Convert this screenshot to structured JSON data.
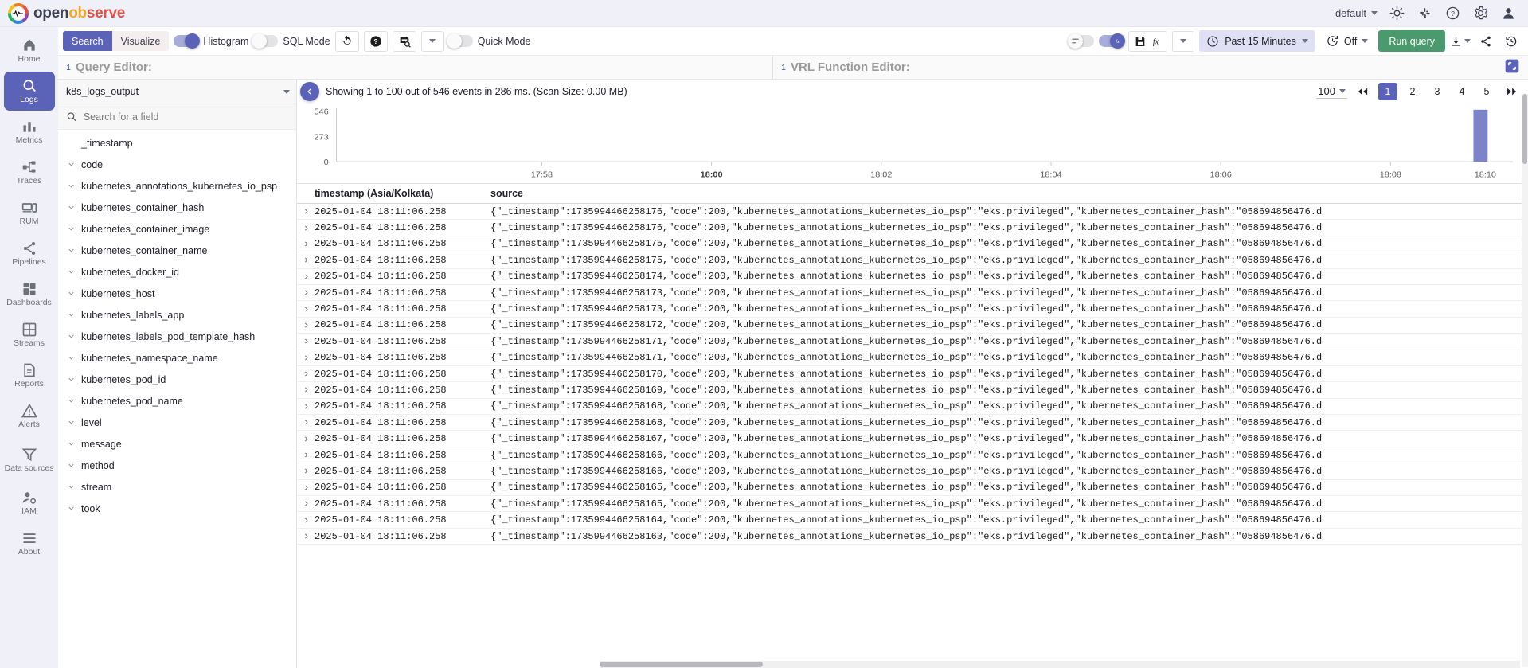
{
  "header": {
    "brand": {
      "open": "open",
      "obs": "ob",
      "serve": "serve"
    },
    "org": "default",
    "icons": {
      "light_mode": "sun-icon",
      "slack": "slack-icon",
      "help": "help-circle-icon",
      "settings": "gear-icon",
      "account": "user-avatar-icon"
    }
  },
  "sidebar": {
    "items": [
      {
        "label": "Home",
        "icon": "home-icon",
        "active": false
      },
      {
        "label": "Logs",
        "icon": "search-icon",
        "active": true
      },
      {
        "label": "Metrics",
        "icon": "bar-chart-icon",
        "active": false
      },
      {
        "label": "Traces",
        "icon": "traces-icon",
        "active": false
      },
      {
        "label": "RUM",
        "icon": "devices-icon",
        "active": false
      },
      {
        "label": "Pipelines",
        "icon": "share-nodes-icon",
        "active": false
      },
      {
        "label": "Dashboards",
        "icon": "grid-icon",
        "active": false
      },
      {
        "label": "Streams",
        "icon": "table-icon",
        "active": false
      },
      {
        "label": "Reports",
        "icon": "document-icon",
        "active": false
      },
      {
        "label": "Alerts",
        "icon": "warning-icon",
        "active": false
      },
      {
        "label": "Data sources",
        "icon": "funnel-icon",
        "active": false
      },
      {
        "label": "IAM",
        "icon": "user-gear-icon",
        "active": false
      },
      {
        "label": "About",
        "icon": "menu-icon",
        "active": false
      }
    ]
  },
  "toolbar": {
    "tab_search": "Search",
    "tab_visualize": "Visualize",
    "histogram_label": "Histogram",
    "histogram_on": true,
    "sql_mode_label": "SQL Mode",
    "sql_mode_on": false,
    "quick_mode_label": "Quick Mode",
    "quick_mode_on": false,
    "refresh_icon": "refresh-icon",
    "help_icon": "help-circle-icon",
    "saved_views_icon": "save-search-icon",
    "saved_views_caret": "chevron-down-icon",
    "wrap_toggle_on": false,
    "fn_toggle_on": true,
    "fn_toggle_label": "fx",
    "save_function_icon": "save-fx-icon",
    "save_function_caret": "chevron-down-icon",
    "time_range": "Past 15 Minutes",
    "time_icon": "clock-icon",
    "time_caret": "chevron-down-icon",
    "auto_refresh": "Off",
    "auto_refresh_icon": "clock-refresh-icon",
    "auto_refresh_caret": "chevron-down-icon",
    "run_query": "Run query",
    "download_icon": "download-icon",
    "download_caret": "chevron-down-icon",
    "share_icon": "share-icon",
    "history_icon": "history-icon"
  },
  "editors": {
    "query_line_no": "1",
    "query_placeholder": "Query Editor:",
    "vrl_line_no": "1",
    "vrl_placeholder": "VRL Function Editor:",
    "expand_icon": "expand-icon"
  },
  "fields_panel": {
    "stream": "k8s_logs_output",
    "stream_caret": "chevron-down-icon",
    "search_icon": "search-icon",
    "search_placeholder": "Search for a field",
    "search_value": "",
    "fields": [
      {
        "name": "_timestamp",
        "expandable": false
      },
      {
        "name": "code",
        "expandable": true
      },
      {
        "name": "kubernetes_annotations_kubernetes_io_psp",
        "expandable": true
      },
      {
        "name": "kubernetes_container_hash",
        "expandable": true
      },
      {
        "name": "kubernetes_container_image",
        "expandable": true
      },
      {
        "name": "kubernetes_container_name",
        "expandable": true
      },
      {
        "name": "kubernetes_docker_id",
        "expandable": true
      },
      {
        "name": "kubernetes_host",
        "expandable": true
      },
      {
        "name": "kubernetes_labels_app",
        "expandable": true
      },
      {
        "name": "kubernetes_labels_pod_template_hash",
        "expandable": true
      },
      {
        "name": "kubernetes_namespace_name",
        "expandable": true
      },
      {
        "name": "kubernetes_pod_id",
        "expandable": true
      },
      {
        "name": "kubernetes_pod_name",
        "expandable": true
      },
      {
        "name": "level",
        "expandable": true
      },
      {
        "name": "message",
        "expandable": true
      },
      {
        "name": "method",
        "expandable": true
      },
      {
        "name": "stream",
        "expandable": true
      },
      {
        "name": "took",
        "expandable": true
      }
    ]
  },
  "results": {
    "collapse_icon": "chevron-left-icon",
    "showing_text": "Showing 1 to 100 out of 546 events in 286 ms. (Scan Size: 0.00 MB)",
    "page_size": "100",
    "page_size_caret": "chevron-down-icon",
    "first_page_icon": "double-chevron-left-icon",
    "last_page_icon": "double-chevron-right-icon",
    "pages": [
      "1",
      "2",
      "3",
      "4",
      "5"
    ],
    "current_page": "1"
  },
  "chart_data": {
    "type": "bar",
    "title": "",
    "xlabel": "",
    "ylabel": "",
    "categories": [
      "17:58",
      "18:00",
      "18:02",
      "18:04",
      "18:06",
      "18:08",
      "18:10"
    ],
    "xtick_labels": [
      "17:58",
      "18:00",
      "18:02",
      "18:04",
      "18:06",
      "18:08",
      "18:10"
    ],
    "xtick_bold": [
      "18:00"
    ],
    "ytick_labels": [
      "546",
      "273",
      "0"
    ],
    "ylim": [
      0,
      546
    ],
    "grid": false,
    "legend": "none",
    "bar_color": "#7b83c9",
    "series": [
      {
        "name": "events",
        "values": [
          0,
          0,
          0,
          0,
          0,
          0,
          546
        ]
      }
    ],
    "bars": [
      {
        "x_fraction": 0.972,
        "value": 546
      }
    ]
  },
  "log_table": {
    "columns": [
      "timestamp (Asia/Kolkata)",
      "source"
    ],
    "expand_icon": "chevron-right-icon",
    "rows": [
      {
        "timestamp": "2025-01-04 18:11:06.258",
        "source": "{\"_timestamp\":1735994466258176,\"code\":200,\"kubernetes_annotations_kubernetes_io_psp\":\"eks.privileged\",\"kubernetes_container_hash\":\"058694856476.d"
      },
      {
        "timestamp": "2025-01-04 18:11:06.258",
        "source": "{\"_timestamp\":1735994466258176,\"code\":200,\"kubernetes_annotations_kubernetes_io_psp\":\"eks.privileged\",\"kubernetes_container_hash\":\"058694856476.d"
      },
      {
        "timestamp": "2025-01-04 18:11:06.258",
        "source": "{\"_timestamp\":1735994466258175,\"code\":200,\"kubernetes_annotations_kubernetes_io_psp\":\"eks.privileged\",\"kubernetes_container_hash\":\"058694856476.d"
      },
      {
        "timestamp": "2025-01-04 18:11:06.258",
        "source": "{\"_timestamp\":1735994466258175,\"code\":200,\"kubernetes_annotations_kubernetes_io_psp\":\"eks.privileged\",\"kubernetes_container_hash\":\"058694856476.d"
      },
      {
        "timestamp": "2025-01-04 18:11:06.258",
        "source": "{\"_timestamp\":1735994466258174,\"code\":200,\"kubernetes_annotations_kubernetes_io_psp\":\"eks.privileged\",\"kubernetes_container_hash\":\"058694856476.d"
      },
      {
        "timestamp": "2025-01-04 18:11:06.258",
        "source": "{\"_timestamp\":1735994466258173,\"code\":200,\"kubernetes_annotations_kubernetes_io_psp\":\"eks.privileged\",\"kubernetes_container_hash\":\"058694856476.d"
      },
      {
        "timestamp": "2025-01-04 18:11:06.258",
        "source": "{\"_timestamp\":1735994466258173,\"code\":200,\"kubernetes_annotations_kubernetes_io_psp\":\"eks.privileged\",\"kubernetes_container_hash\":\"058694856476.d"
      },
      {
        "timestamp": "2025-01-04 18:11:06.258",
        "source": "{\"_timestamp\":1735994466258172,\"code\":200,\"kubernetes_annotations_kubernetes_io_psp\":\"eks.privileged\",\"kubernetes_container_hash\":\"058694856476.d"
      },
      {
        "timestamp": "2025-01-04 18:11:06.258",
        "source": "{\"_timestamp\":1735994466258171,\"code\":200,\"kubernetes_annotations_kubernetes_io_psp\":\"eks.privileged\",\"kubernetes_container_hash\":\"058694856476.d"
      },
      {
        "timestamp": "2025-01-04 18:11:06.258",
        "source": "{\"_timestamp\":1735994466258171,\"code\":200,\"kubernetes_annotations_kubernetes_io_psp\":\"eks.privileged\",\"kubernetes_container_hash\":\"058694856476.d"
      },
      {
        "timestamp": "2025-01-04 18:11:06.258",
        "source": "{\"_timestamp\":1735994466258170,\"code\":200,\"kubernetes_annotations_kubernetes_io_psp\":\"eks.privileged\",\"kubernetes_container_hash\":\"058694856476.d"
      },
      {
        "timestamp": "2025-01-04 18:11:06.258",
        "source": "{\"_timestamp\":1735994466258169,\"code\":200,\"kubernetes_annotations_kubernetes_io_psp\":\"eks.privileged\",\"kubernetes_container_hash\":\"058694856476.d"
      },
      {
        "timestamp": "2025-01-04 18:11:06.258",
        "source": "{\"_timestamp\":1735994466258168,\"code\":200,\"kubernetes_annotations_kubernetes_io_psp\":\"eks.privileged\",\"kubernetes_container_hash\":\"058694856476.d"
      },
      {
        "timestamp": "2025-01-04 18:11:06.258",
        "source": "{\"_timestamp\":1735994466258168,\"code\":200,\"kubernetes_annotations_kubernetes_io_psp\":\"eks.privileged\",\"kubernetes_container_hash\":\"058694856476.d"
      },
      {
        "timestamp": "2025-01-04 18:11:06.258",
        "source": "{\"_timestamp\":1735994466258167,\"code\":200,\"kubernetes_annotations_kubernetes_io_psp\":\"eks.privileged\",\"kubernetes_container_hash\":\"058694856476.d"
      },
      {
        "timestamp": "2025-01-04 18:11:06.258",
        "source": "{\"_timestamp\":1735994466258166,\"code\":200,\"kubernetes_annotations_kubernetes_io_psp\":\"eks.privileged\",\"kubernetes_container_hash\":\"058694856476.d"
      },
      {
        "timestamp": "2025-01-04 18:11:06.258",
        "source": "{\"_timestamp\":1735994466258166,\"code\":200,\"kubernetes_annotations_kubernetes_io_psp\":\"eks.privileged\",\"kubernetes_container_hash\":\"058694856476.d"
      },
      {
        "timestamp": "2025-01-04 18:11:06.258",
        "source": "{\"_timestamp\":1735994466258165,\"code\":200,\"kubernetes_annotations_kubernetes_io_psp\":\"eks.privileged\",\"kubernetes_container_hash\":\"058694856476.d"
      },
      {
        "timestamp": "2025-01-04 18:11:06.258",
        "source": "{\"_timestamp\":1735994466258165,\"code\":200,\"kubernetes_annotations_kubernetes_io_psp\":\"eks.privileged\",\"kubernetes_container_hash\":\"058694856476.d"
      },
      {
        "timestamp": "2025-01-04 18:11:06.258",
        "source": "{\"_timestamp\":1735994466258164,\"code\":200,\"kubernetes_annotations_kubernetes_io_psp\":\"eks.privileged\",\"kubernetes_container_hash\":\"058694856476.d"
      },
      {
        "timestamp": "2025-01-04 18:11:06.258",
        "source": "{\"_timestamp\":1735994466258163,\"code\":200,\"kubernetes_annotations_kubernetes_io_psp\":\"eks.privileged\",\"kubernetes_container_hash\":\"058694856476.d"
      }
    ]
  }
}
